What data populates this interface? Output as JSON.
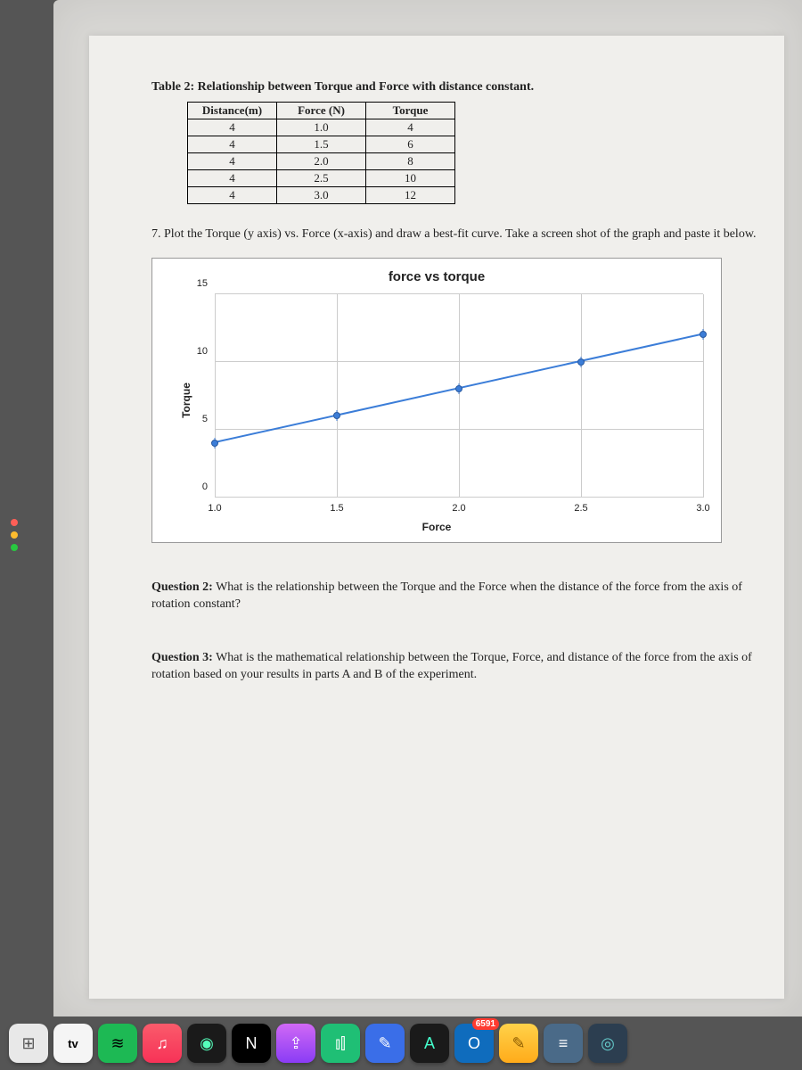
{
  "title": "Table 2: Relationship between Torque and Force with distance constant.",
  "table": {
    "headers": [
      "Distance(m)",
      "Force (N)",
      "Torque"
    ],
    "rows": [
      [
        "4",
        "1.0",
        "4"
      ],
      [
        "4",
        "1.5",
        "6"
      ],
      [
        "4",
        "2.0",
        "8"
      ],
      [
        "4",
        "2.5",
        "10"
      ],
      [
        "4",
        "3.0",
        "12"
      ]
    ]
  },
  "instruction": "7. Plot the Torque (y axis) vs. Force (x-axis) and draw a best-fit curve.  Take a screen shot of the graph and paste it below.",
  "chart_data": {
    "type": "scatter",
    "title": "force vs torque",
    "xlabel": "Force",
    "ylabel": "Torque",
    "x": [
      1.0,
      1.5,
      2.0,
      2.5,
      3.0
    ],
    "y": [
      4,
      6,
      8,
      10,
      12
    ],
    "xlim": [
      1.0,
      3.0
    ],
    "ylim": [
      0,
      15
    ],
    "x_ticks": [
      "1.0",
      "1.5",
      "2.0",
      "2.5",
      "3.0"
    ],
    "y_ticks": [
      "0",
      "5",
      "10",
      "15"
    ],
    "trendline": true,
    "error_bars": true
  },
  "question2_label": "Question 2:",
  "question2_text": " What is the relationship between the Torque and the Force when the distance of the force from the axis of rotation constant?",
  "question3_label": "Question 3:",
  "question3_text": " What is the mathematical relationship between the Torque, Force,  and distance of the force from the axis of rotation based on your results in parts A and B of the experiment.",
  "dock": {
    "items": [
      {
        "name": "finder-icon",
        "bg": "#e8e8e8",
        "glyph": "⊞",
        "color": "#555"
      },
      {
        "name": "appletv-icon",
        "bg": "#f5f5f5",
        "glyph": "tv",
        "color": "#000"
      },
      {
        "name": "spotify-icon",
        "bg": "#1db954",
        "glyph": "≋",
        "color": "#000"
      },
      {
        "name": "music-icon",
        "bg": "linear-gradient(#fa5b6b,#f73257)",
        "glyph": "♫",
        "color": "#fff"
      },
      {
        "name": "siri-icon",
        "bg": "#1a1a1a",
        "glyph": "◉",
        "color": "#5fb"
      },
      {
        "name": "notion-icon",
        "bg": "#000",
        "glyph": "N",
        "color": "#fff"
      },
      {
        "name": "podcast-icon",
        "bg": "linear-gradient(#d069f5,#8a3cf5)",
        "glyph": "⇪",
        "color": "#fff"
      },
      {
        "name": "stats-icon",
        "bg": "#1fbf75",
        "glyph": "⫾⫿",
        "color": "#fff"
      },
      {
        "name": "edit-icon",
        "bg": "#3a6ee8",
        "glyph": "✎",
        "color": "#fff"
      },
      {
        "name": "translate-icon",
        "bg": "#1a1a1a",
        "glyph": "A",
        "color": "#4fc"
      },
      {
        "name": "outlook-icon",
        "bg": "#0f6cbd",
        "glyph": "O",
        "color": "#fff",
        "badge": "6591"
      },
      {
        "name": "notes-icon",
        "bg": "linear-gradient(#ffd24a,#ffab1a)",
        "glyph": "✎",
        "color": "#8a5a00"
      },
      {
        "name": "docs-icon",
        "bg": "#4a6a88",
        "glyph": "≡",
        "color": "#fff"
      },
      {
        "name": "circle-icon",
        "bg": "#2c3e50",
        "glyph": "◎",
        "color": "#6cc"
      }
    ]
  }
}
